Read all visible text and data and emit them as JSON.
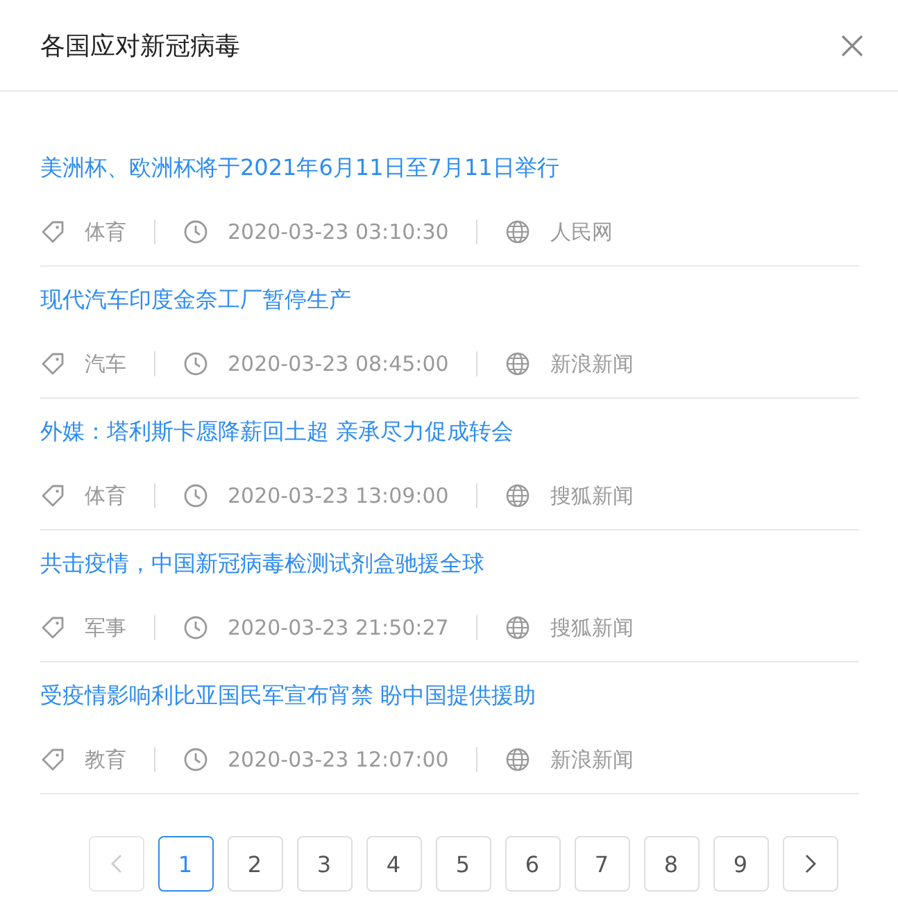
{
  "dialog": {
    "title": "各国应对新冠病毒"
  },
  "items": [
    {
      "title": "美洲杯、欧洲杯将于2021年6月11日至7月11日举行",
      "category": "体育",
      "time": "2020-03-23 03:10:30",
      "source": "人民网"
    },
    {
      "title": "现代汽车印度金奈工厂暂停生产",
      "category": "汽车",
      "time": "2020-03-23 08:45:00",
      "source": "新浪新闻"
    },
    {
      "title": "外媒：塔利斯卡愿降薪回土超 亲承尽力促成转会",
      "category": "体育",
      "time": "2020-03-23 13:09:00",
      "source": "搜狐新闻"
    },
    {
      "title": "共击疫情，中国新冠病毒检测试剂盒驰援全球",
      "category": "军事",
      "time": "2020-03-23 21:50:27",
      "source": "搜狐新闻"
    },
    {
      "title": "受疫情影响利比亚国民军宣布宵禁 盼中国提供援助",
      "category": "教育",
      "time": "2020-03-23 12:07:00",
      "source": "新浪新闻"
    }
  ],
  "pagination": {
    "prev_disabled": true,
    "next_disabled": false,
    "pages": [
      {
        "label": "1",
        "selected": true
      },
      {
        "label": "2",
        "selected": false
      },
      {
        "label": "3",
        "selected": false
      },
      {
        "label": "4",
        "selected": false
      },
      {
        "label": "5",
        "selected": false
      },
      {
        "label": "6",
        "selected": false
      },
      {
        "label": "7",
        "selected": false
      },
      {
        "label": "8",
        "selected": false
      },
      {
        "label": "9",
        "selected": false
      }
    ]
  }
}
